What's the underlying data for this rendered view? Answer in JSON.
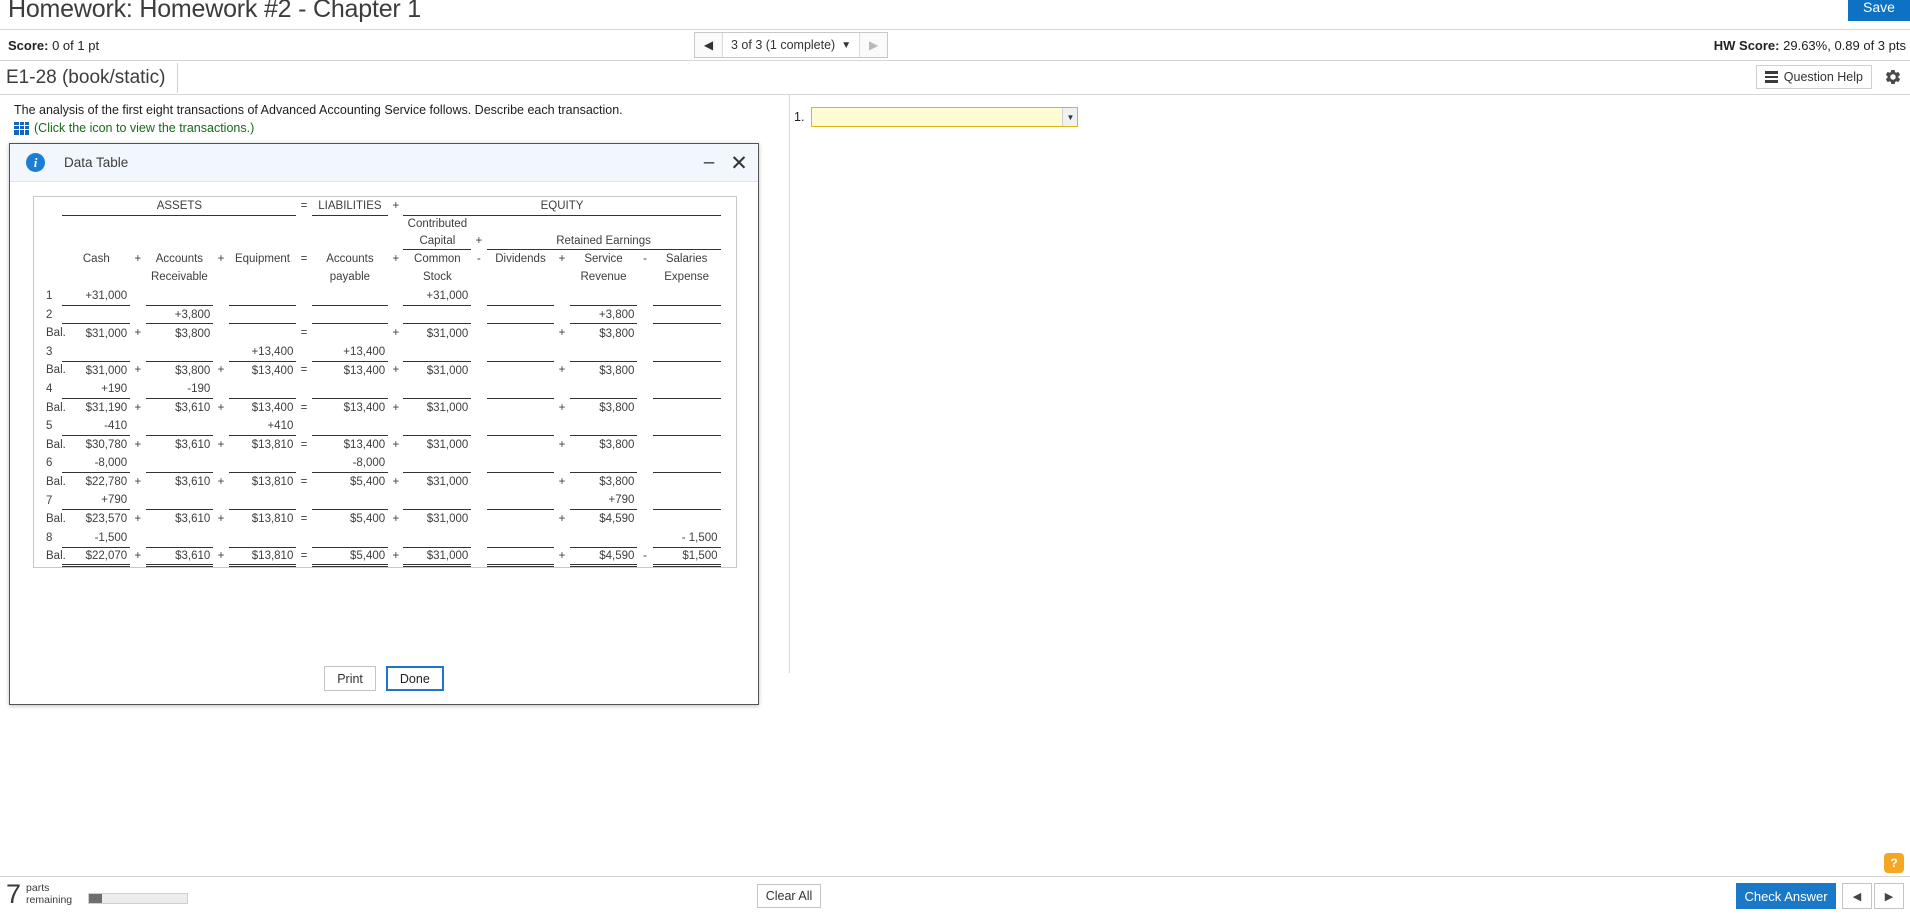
{
  "header": {
    "title": "Homework: Homework #2 - Chapter 1",
    "save_label": "Save"
  },
  "scorebar": {
    "score_label": "Score:",
    "score_value": "0 of 1 pt",
    "nav_label": "3 of 3 (1 complete)",
    "prev_icon": "◀",
    "next_icon": "▶",
    "caret_icon": "▼",
    "hw_score_label": "HW Score:",
    "hw_score_value": "29.63%, 0.89 of 3 pts"
  },
  "exercise": {
    "id": "E1-28 (book/static)",
    "question_help": "Question Help",
    "gear_icon": "gear-icon"
  },
  "content": {
    "prompt": "The analysis of the first eight transactions of Advanced Accounting Service follows. Describe each transaction.",
    "table_link": "(Click the icon to view the transactions.)",
    "grid_icon": "table-grid-icon"
  },
  "answer": {
    "number": "1.",
    "value": "",
    "caret_icon": "▼"
  },
  "modal": {
    "title": "Data Table",
    "info_icon": "i",
    "minimize_icon": "–",
    "close_icon": "✕",
    "print_label": "Print",
    "done_label": "Done"
  },
  "worksheet": {
    "groups": {
      "assets": "ASSETS",
      "eq1": "=",
      "liabilities": "LIABILITIES",
      "plus1": "+",
      "equity": "EQUITY",
      "contributed": "Contributed",
      "capital": "Capital",
      "plus2": "+",
      "retained": "Retained Earnings"
    },
    "columns": {
      "cash": "Cash",
      "op_cash_ar": "+",
      "accounts": "Accounts",
      "receivable": "Receivable",
      "op_ar_eq": "+",
      "equipment": "Equipment",
      "op_eq_ap": "=",
      "accounts_p": "Accounts",
      "payable": "payable",
      "op_ap_cs": "+",
      "common": "Common",
      "stock": "Stock",
      "op_cs_div": "-",
      "dividends": "Dividends",
      "op_div_rev": "+",
      "service": "Service",
      "revenue": "Revenue",
      "op_rev_exp": "-",
      "salaries": "Salaries",
      "expense": "Expense"
    },
    "rows": [
      {
        "label": "1",
        "type": "txn",
        "cash": "+31,000",
        "ar": "",
        "eq": "",
        "ap": "",
        "cs": "+31,000",
        "div": "",
        "rev": "",
        "exp": ""
      },
      {
        "label": "2",
        "type": "txn",
        "cash": "",
        "ar": "+3,800",
        "eq": "",
        "ap": "",
        "cs": "",
        "div": "",
        "rev": "+3,800",
        "exp": ""
      },
      {
        "label": "Bal.",
        "type": "bal",
        "cash": "$31,000",
        "ar": "$3,800",
        "eq": "",
        "ap": "",
        "cs": "$31,000",
        "div": "",
        "rev": "$3,800",
        "exp": ""
      },
      {
        "label": "3",
        "type": "txn",
        "cash": "",
        "ar": "",
        "eq": "+13,400",
        "ap": "+13,400",
        "cs": "",
        "div": "",
        "rev": "",
        "exp": ""
      },
      {
        "label": "Bal.",
        "type": "bal",
        "cash": "$31,000",
        "ar": "$3,800",
        "eq": "$13,400",
        "ap": "$13,400",
        "cs": "$31,000",
        "div": "",
        "rev": "$3,800",
        "exp": ""
      },
      {
        "label": "4",
        "type": "txn",
        "cash": "+190",
        "ar": "-190",
        "eq": "",
        "ap": "",
        "cs": "",
        "div": "",
        "rev": "",
        "exp": ""
      },
      {
        "label": "Bal.",
        "type": "bal",
        "cash": "$31,190",
        "ar": "$3,610",
        "eq": "$13,400",
        "ap": "$13,400",
        "cs": "$31,000",
        "div": "",
        "rev": "$3,800",
        "exp": ""
      },
      {
        "label": "5",
        "type": "txn",
        "cash": "-410",
        "ar": "",
        "eq": "+410",
        "ap": "",
        "cs": "",
        "div": "",
        "rev": "",
        "exp": ""
      },
      {
        "label": "Bal.",
        "type": "bal",
        "cash": "$30,780",
        "ar": "$3,610",
        "eq": "$13,810",
        "ap": "$13,400",
        "cs": "$31,000",
        "div": "",
        "rev": "$3,800",
        "exp": ""
      },
      {
        "label": "6",
        "type": "txn",
        "cash": "-8,000",
        "ar": "",
        "eq": "",
        "ap": "-8,000",
        "cs": "",
        "div": "",
        "rev": "",
        "exp": ""
      },
      {
        "label": "Bal.",
        "type": "bal",
        "cash": "$22,780",
        "ar": "$3,610",
        "eq": "$13,810",
        "ap": "$5,400",
        "cs": "$31,000",
        "div": "",
        "rev": "$3,800",
        "exp": ""
      },
      {
        "label": "7",
        "type": "txn",
        "cash": "+790",
        "ar": "",
        "eq": "",
        "ap": "",
        "cs": "",
        "div": "",
        "rev": "+790",
        "exp": ""
      },
      {
        "label": "Bal.",
        "type": "bal",
        "cash": "$23,570",
        "ar": "$3,610",
        "eq": "$13,810",
        "ap": "$5,400",
        "cs": "$31,000",
        "div": "",
        "rev": "$4,590",
        "exp": ""
      },
      {
        "label": "8",
        "type": "txn",
        "cash": "-1,500",
        "ar": "",
        "eq": "",
        "ap": "",
        "cs": "",
        "div": "",
        "rev": "",
        "exp": "- 1,500"
      },
      {
        "label": "Bal.",
        "type": "final",
        "cash": "$22,070",
        "ar": "$3,610",
        "eq": "$13,810",
        "ap": "$5,400",
        "cs": "$31,000",
        "div": "",
        "rev": "$4,590",
        "exp": "$1,500"
      }
    ]
  },
  "bottombar": {
    "parts_number": "7",
    "parts_line1": "parts",
    "parts_line2": "remaining",
    "clear_all": "Clear All",
    "check_answer": "Check Answer",
    "prev_icon": "◀",
    "next_icon": "▶",
    "help_icon": "?"
  }
}
